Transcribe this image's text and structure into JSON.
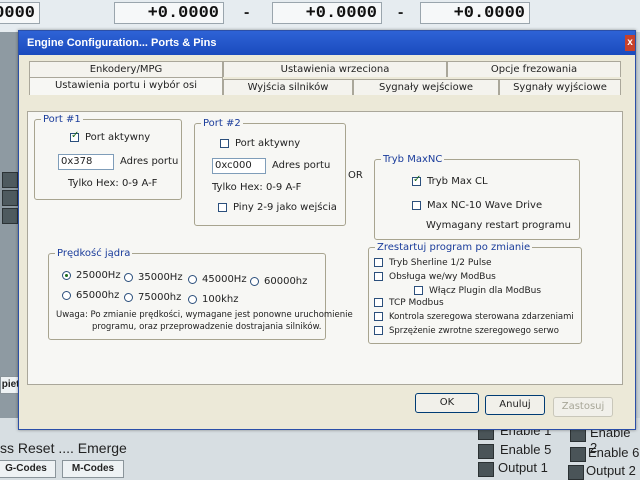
{
  "background": {
    "dro_values": [
      "0000",
      "+0.0000",
      "+0.0000",
      "+0.0000"
    ],
    "dashes": [
      "-",
      "-"
    ],
    "bottom_text": "ss Reset .... Emerge",
    "left_button": "pietl",
    "gcodes_button": "G-Codes",
    "mcodes_button": "M-Codes",
    "side_items": [
      "Enable 1",
      "Enable 2",
      "Enable 5",
      "Enable 6",
      "Output 1",
      "Output 2"
    ]
  },
  "dialog": {
    "title": "Engine Configuration... Ports & Pins",
    "tabs_row1": [
      "Enkodery/MPG",
      "Ustawienia wrzeciona",
      "Opcje frezowania"
    ],
    "tabs_row2": [
      "Ustawienia portu i wybór osi",
      "Wyjścia silników",
      "Sygnały wejściowe",
      "Sygnały wyjściowe"
    ],
    "port1": {
      "legend": "Port #1",
      "active_label": "Port aktywny",
      "active_checked": true,
      "address_value": "0x378",
      "address_label": "Adres portu",
      "hex_note": "Tylko Hex: 0-9 A-F"
    },
    "port2": {
      "legend": "Port #2",
      "active_label": "Port aktywny",
      "active_checked": false,
      "address_value": "0xc000",
      "address_label": "Adres portu",
      "hex_note": "Tylko Hex: 0-9 A-F",
      "pins_label": "Piny 2-9 jako wejścia"
    },
    "or_label": "OR",
    "maxnc": {
      "legend": "Tryb MaxNC",
      "tryb_label": "Tryb Max CL",
      "tryb_checked": true,
      "wave_label": "Max NC-10 Wave Drive",
      "wave_checked": false,
      "note": "Wymagany restart programu"
    },
    "speed": {
      "legend": "Prędkość jądra",
      "options": [
        "25000Hz",
        "35000Hz",
        "45000Hz",
        "60000hz",
        "65000hz",
        "75000hz",
        "100khz"
      ],
      "selected": "25000Hz",
      "note_line1": "Uwaga: Po zmianie prędkości, wymagane jest ponowne uruchomienie",
      "note_line2": "programu, oraz przeprowadzenie dostrajania silników."
    },
    "restart": {
      "legend": "Zrestartuj program po zmianie",
      "items": [
        "Tryb Sherline 1/2 Pulse",
        "Obsługa we/wy ModBus",
        "Włącz Plugin dla ModBus",
        "TCP Modbus",
        "Kontrola szeregowa sterowana zdarzeniami",
        "Sprzężenie zwrotne szeregowego serwo"
      ]
    },
    "buttons": {
      "ok": "OK",
      "cancel": "Anuluj",
      "apply": "Zastosuj"
    },
    "close_symbol": "x"
  },
  "colors": {
    "titlebar": "#1a4bbd",
    "dialog_bg": "#ece9d8",
    "legend": "#1a3c9b"
  }
}
